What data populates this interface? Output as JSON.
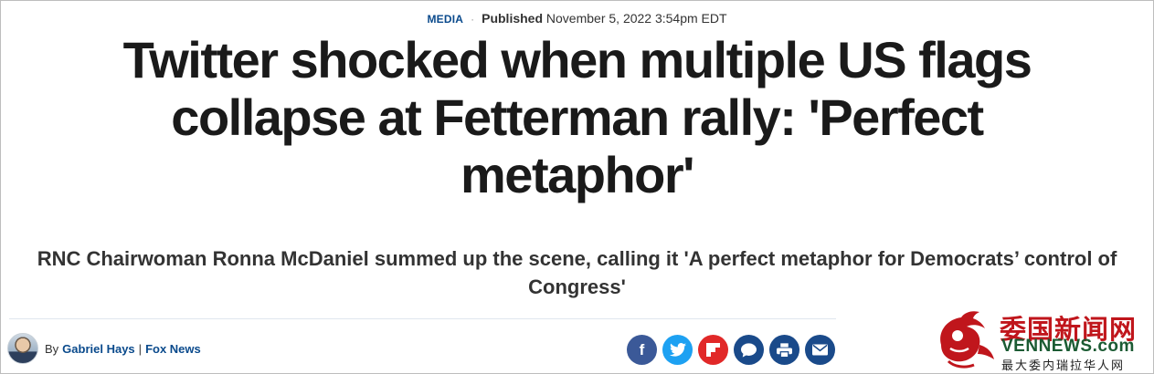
{
  "article": {
    "category": "MEDIA",
    "separator": "·",
    "published_label": "Published",
    "published_date": "November 5, 2022 3:54pm EDT",
    "headline": "Twitter shocked when multiple US flags collapse at Fetterman rally: 'Perfect metaphor'",
    "subheadline": "RNC Chairwoman Ronna McDaniel summed up the scene, calling it 'A perfect metaphor for Democrats’ control of Congress'",
    "byline_prefix": "By",
    "author": "Gabriel Hays",
    "byline_separator": "|",
    "outlet": "Fox News"
  },
  "share": {
    "facebook_glyph": "f",
    "twitter_glyph": "t",
    "flipboard_glyph": "F",
    "comment_glyph": "💬",
    "print_glyph": "⎙",
    "email_glyph": "✉"
  },
  "watermark": {
    "title": "委国新闻网",
    "url": "VENNEWS.com",
    "slogan": "最大委内瑞拉华人网"
  },
  "colors": {
    "category_link": "#0a4a8c",
    "facebook": "#3b5998",
    "twitter": "#1da1f2",
    "flipboard": "#e12828",
    "share_dark": "#1a4a8a",
    "watermark_red": "#c0161c",
    "watermark_green": "#1b5b33"
  }
}
